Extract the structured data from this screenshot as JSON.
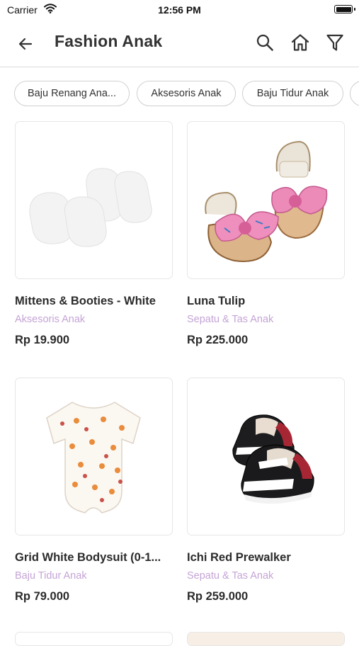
{
  "status_bar": {
    "carrier": "Carrier",
    "time": "12:56 PM"
  },
  "header": {
    "title": "Fashion Anak"
  },
  "chips": [
    {
      "label": "Baju Renang Ana..."
    },
    {
      "label": "Aksesoris Anak"
    },
    {
      "label": "Baju Tidur Anak"
    },
    {
      "label": ""
    }
  ],
  "products": [
    {
      "name": "Mittens & Booties - White",
      "category": "Aksesoris Anak",
      "price": "Rp 19.900"
    },
    {
      "name": "Luna Tulip",
      "category": "Sepatu & Tas Anak",
      "price": "Rp 225.000"
    },
    {
      "name": "Grid White Bodysuit (0-1...",
      "category": "Baju Tidur Anak",
      "price": "Rp 79.000"
    },
    {
      "name": "Ichi Red Prewalker",
      "category": "Sepatu & Tas Anak",
      "price": "Rp 259.000"
    }
  ],
  "colors": {
    "category_text": "#c5a4d6",
    "divider": "#dcdcdc",
    "chip_border": "#cfcfcf"
  }
}
